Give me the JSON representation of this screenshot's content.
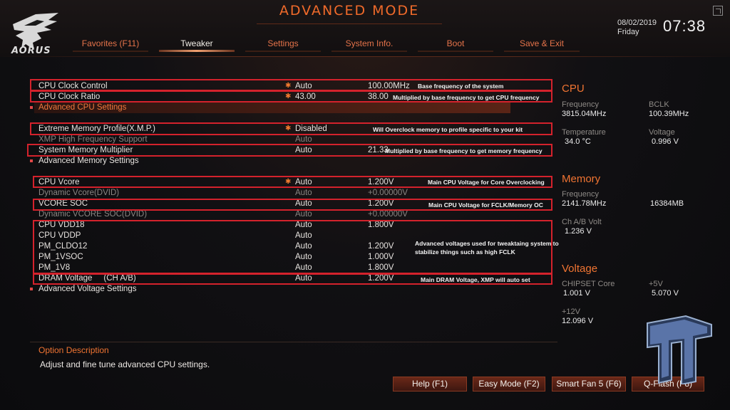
{
  "header": {
    "mode_title": "ADVANCED MODE",
    "logo_text": "AORUS",
    "date": "08/02/2019",
    "day": "Friday",
    "time": "07:38"
  },
  "tabs": [
    {
      "label": "Favorites (F11)"
    },
    {
      "label": "Tweaker",
      "active": true
    },
    {
      "label": "Settings"
    },
    {
      "label": "System Info."
    },
    {
      "label": "Boot"
    },
    {
      "label": "Save & Exit"
    }
  ],
  "settings": [
    {
      "name": "CPU Clock Control",
      "value": "Auto",
      "current": "100.00MHz",
      "star": true
    },
    {
      "name": "CPU Clock Ratio",
      "value": "43.00",
      "current": "38.00",
      "star": true
    },
    {
      "name": "Advanced CPU Settings",
      "submenu": true
    },
    {
      "name": "Extreme Memory Profile(X.M.P.)",
      "value": "Disabled",
      "star": true
    },
    {
      "name": "XMP High Frequency Support",
      "value": "Auto",
      "dim": true
    },
    {
      "name": "System Memory Multiplier",
      "value": "Auto",
      "current": "21.33"
    },
    {
      "name": "Advanced Memory Settings",
      "submenu": true
    },
    {
      "name": "CPU Vcore",
      "value": "Auto",
      "current": "1.200V",
      "star": true
    },
    {
      "name": "Dynamic Vcore(DVID)",
      "value": "Auto",
      "current": "+0.00000V",
      "dim": true
    },
    {
      "name": "VCORE SOC",
      "value": "Auto",
      "current": "1.200V"
    },
    {
      "name": "Dynamic VCORE SOC(DVID)",
      "value": "Auto",
      "current": "+0.00000V",
      "dim": true
    },
    {
      "name": "CPU VDD18",
      "value": "Auto",
      "current": "1.800V"
    },
    {
      "name": "CPU VDDP",
      "value": "Auto",
      "current": ""
    },
    {
      "name": "PM_CLDO12",
      "value": "Auto",
      "current": "1.200V"
    },
    {
      "name": "PM_1VSOC",
      "value": "Auto",
      "current": "1.000V"
    },
    {
      "name": "PM_1V8",
      "value": "Auto",
      "current": "1.800V"
    },
    {
      "name": "DRAM Voltage     (CH A/B)",
      "value": "Auto",
      "current": "1.200V"
    },
    {
      "name": "Advanced Voltage Settings",
      "submenu": true
    }
  ],
  "notes": {
    "n1": "Base frequency of the system",
    "n2": "Multiplied by base frequency to get CPU frequency",
    "n3": "Will Overclock memory to profile specific to your kit",
    "n4": "Multiplied by base frequency to get memory frequency",
    "n5": "Main CPU Voltage for Core Overclocking",
    "n6": "Main CPU Voltage for FCLK/Memory OC",
    "n7a": "Advanced voltages used for tweaktaing system to",
    "n7b": "stabilize things such as high FCLK",
    "n8": "Main DRAM Voltage, XMP will auto set"
  },
  "cpu": {
    "title": "CPU",
    "frequency_label": "Frequency",
    "frequency": "3815.04MHz",
    "bclk_label": "BCLK",
    "bclk": "100.39MHz",
    "temperature_label": "Temperature",
    "temperature": "34.0 °C",
    "voltage_label": "Voltage",
    "voltage": "0.996 V"
  },
  "memory": {
    "title": "Memory",
    "frequency_label": "Frequency",
    "frequency": "2141.78MHz",
    "size": "16384MB",
    "ch_volt_label": "Ch A/B Volt",
    "ch_volt": "1.236 V"
  },
  "voltage": {
    "title": "Voltage",
    "chipset_label": "CHIPSET Core",
    "chipset": "1.001 V",
    "p5v_label": "+5V",
    "p5v": "5.070 V",
    "p12v_label": "+12V",
    "p12v": "12.096 V"
  },
  "option": {
    "title": "Option Description",
    "text": "Adjust and fine tune advanced CPU settings."
  },
  "buttons": {
    "help": "Help (F1)",
    "easy": "Easy Mode (F2)",
    "fan": "Smart Fan 5 (F6)",
    "qflash": "Q-Flash (F8)"
  },
  "colors": {
    "accent": "#f07432",
    "annotation_box": "#d4222c"
  }
}
